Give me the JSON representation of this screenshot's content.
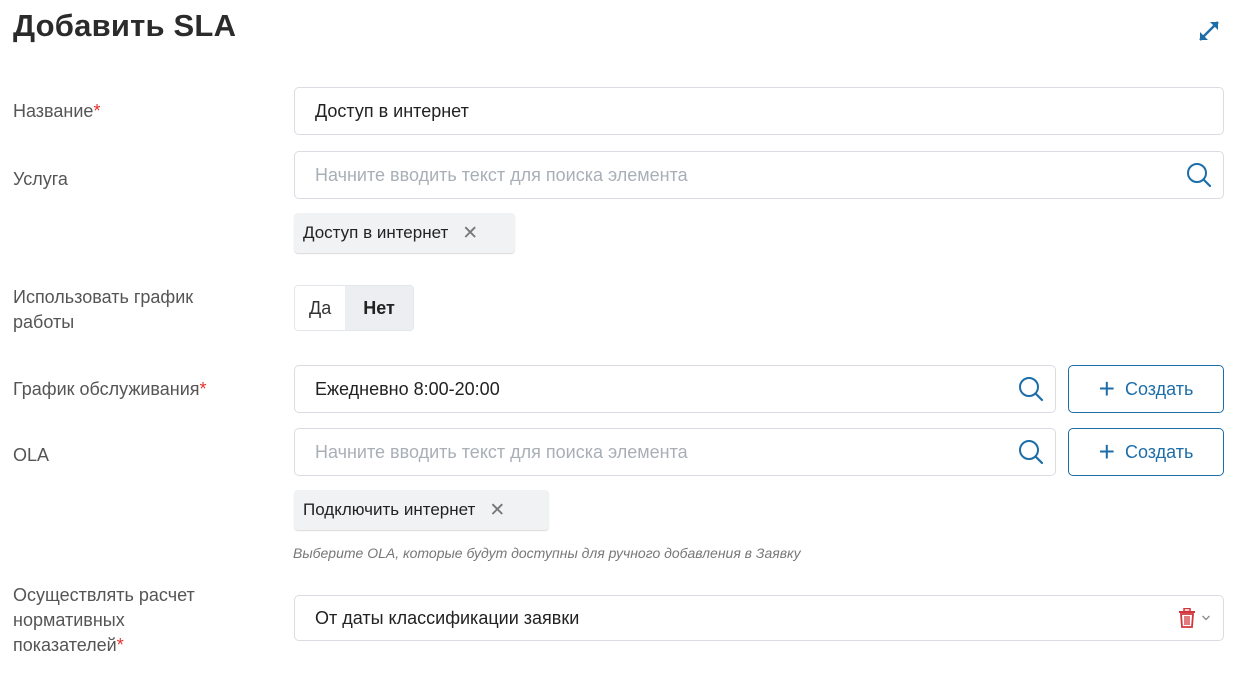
{
  "dialog": {
    "title": "Добавить SLA",
    "expand_icon": "expand-icon"
  },
  "fields": {
    "name": {
      "label": "Название",
      "required": "*",
      "value": "Доступ в интернет"
    },
    "service": {
      "label": "Услуга",
      "placeholder": "Начните вводить текст для поиска элемента",
      "selected_chip": "Доступ в интернет",
      "search_icon": "search-icon"
    },
    "use_schedule": {
      "label_line1": "Использовать график",
      "label_line2": "работы",
      "options": [
        "Да",
        "Нет"
      ],
      "selected": "Нет"
    },
    "service_schedule": {
      "label": "График обслуживания",
      "required": "*",
      "value": "Ежедневно 8:00-20:00",
      "create_label": "Создать"
    },
    "ola": {
      "label": "OLA",
      "placeholder": "Начните вводить текст для поиска элемента",
      "create_label": "Создать",
      "selected_chip": "Подключить интернет",
      "hint": "Выберите OLA, которые будут доступны для ручного добавления в Заявку"
    },
    "calculation": {
      "label_line1": "Осуществлять расчет",
      "label_line2": "нормативных",
      "label_line3": "показателей",
      "required": "*",
      "value": "От даты классификации заявки"
    }
  },
  "colors": {
    "accent": "#1d6ea8",
    "required": "#e0302a",
    "delete": "#d0363b"
  }
}
